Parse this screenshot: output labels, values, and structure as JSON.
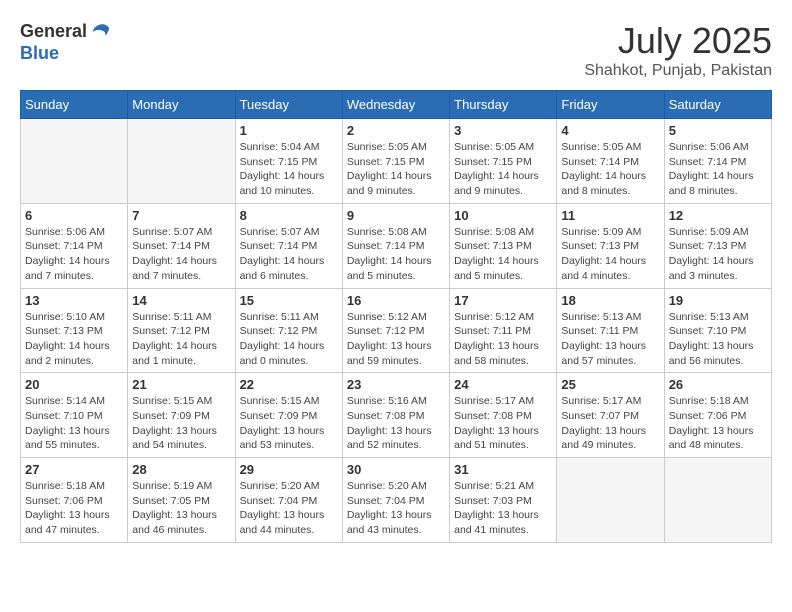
{
  "logo": {
    "general": "General",
    "blue": "Blue"
  },
  "header": {
    "title": "July 2025",
    "subtitle": "Shahkot, Punjab, Pakistan"
  },
  "days_of_week": [
    "Sunday",
    "Monday",
    "Tuesday",
    "Wednesday",
    "Thursday",
    "Friday",
    "Saturday"
  ],
  "weeks": [
    [
      {
        "day": "",
        "info": ""
      },
      {
        "day": "",
        "info": ""
      },
      {
        "day": "1",
        "info": "Sunrise: 5:04 AM\nSunset: 7:15 PM\nDaylight: 14 hours and 10 minutes."
      },
      {
        "day": "2",
        "info": "Sunrise: 5:05 AM\nSunset: 7:15 PM\nDaylight: 14 hours and 9 minutes."
      },
      {
        "day": "3",
        "info": "Sunrise: 5:05 AM\nSunset: 7:15 PM\nDaylight: 14 hours and 9 minutes."
      },
      {
        "day": "4",
        "info": "Sunrise: 5:05 AM\nSunset: 7:14 PM\nDaylight: 14 hours and 8 minutes."
      },
      {
        "day": "5",
        "info": "Sunrise: 5:06 AM\nSunset: 7:14 PM\nDaylight: 14 hours and 8 minutes."
      }
    ],
    [
      {
        "day": "6",
        "info": "Sunrise: 5:06 AM\nSunset: 7:14 PM\nDaylight: 14 hours and 7 minutes."
      },
      {
        "day": "7",
        "info": "Sunrise: 5:07 AM\nSunset: 7:14 PM\nDaylight: 14 hours and 7 minutes."
      },
      {
        "day": "8",
        "info": "Sunrise: 5:07 AM\nSunset: 7:14 PM\nDaylight: 14 hours and 6 minutes."
      },
      {
        "day": "9",
        "info": "Sunrise: 5:08 AM\nSunset: 7:14 PM\nDaylight: 14 hours and 5 minutes."
      },
      {
        "day": "10",
        "info": "Sunrise: 5:08 AM\nSunset: 7:13 PM\nDaylight: 14 hours and 5 minutes."
      },
      {
        "day": "11",
        "info": "Sunrise: 5:09 AM\nSunset: 7:13 PM\nDaylight: 14 hours and 4 minutes."
      },
      {
        "day": "12",
        "info": "Sunrise: 5:09 AM\nSunset: 7:13 PM\nDaylight: 14 hours and 3 minutes."
      }
    ],
    [
      {
        "day": "13",
        "info": "Sunrise: 5:10 AM\nSunset: 7:13 PM\nDaylight: 14 hours and 2 minutes."
      },
      {
        "day": "14",
        "info": "Sunrise: 5:11 AM\nSunset: 7:12 PM\nDaylight: 14 hours and 1 minute."
      },
      {
        "day": "15",
        "info": "Sunrise: 5:11 AM\nSunset: 7:12 PM\nDaylight: 14 hours and 0 minutes."
      },
      {
        "day": "16",
        "info": "Sunrise: 5:12 AM\nSunset: 7:12 PM\nDaylight: 13 hours and 59 minutes."
      },
      {
        "day": "17",
        "info": "Sunrise: 5:12 AM\nSunset: 7:11 PM\nDaylight: 13 hours and 58 minutes."
      },
      {
        "day": "18",
        "info": "Sunrise: 5:13 AM\nSunset: 7:11 PM\nDaylight: 13 hours and 57 minutes."
      },
      {
        "day": "19",
        "info": "Sunrise: 5:13 AM\nSunset: 7:10 PM\nDaylight: 13 hours and 56 minutes."
      }
    ],
    [
      {
        "day": "20",
        "info": "Sunrise: 5:14 AM\nSunset: 7:10 PM\nDaylight: 13 hours and 55 minutes."
      },
      {
        "day": "21",
        "info": "Sunrise: 5:15 AM\nSunset: 7:09 PM\nDaylight: 13 hours and 54 minutes."
      },
      {
        "day": "22",
        "info": "Sunrise: 5:15 AM\nSunset: 7:09 PM\nDaylight: 13 hours and 53 minutes."
      },
      {
        "day": "23",
        "info": "Sunrise: 5:16 AM\nSunset: 7:08 PM\nDaylight: 13 hours and 52 minutes."
      },
      {
        "day": "24",
        "info": "Sunrise: 5:17 AM\nSunset: 7:08 PM\nDaylight: 13 hours and 51 minutes."
      },
      {
        "day": "25",
        "info": "Sunrise: 5:17 AM\nSunset: 7:07 PM\nDaylight: 13 hours and 49 minutes."
      },
      {
        "day": "26",
        "info": "Sunrise: 5:18 AM\nSunset: 7:06 PM\nDaylight: 13 hours and 48 minutes."
      }
    ],
    [
      {
        "day": "27",
        "info": "Sunrise: 5:18 AM\nSunset: 7:06 PM\nDaylight: 13 hours and 47 minutes."
      },
      {
        "day": "28",
        "info": "Sunrise: 5:19 AM\nSunset: 7:05 PM\nDaylight: 13 hours and 46 minutes."
      },
      {
        "day": "29",
        "info": "Sunrise: 5:20 AM\nSunset: 7:04 PM\nDaylight: 13 hours and 44 minutes."
      },
      {
        "day": "30",
        "info": "Sunrise: 5:20 AM\nSunset: 7:04 PM\nDaylight: 13 hours and 43 minutes."
      },
      {
        "day": "31",
        "info": "Sunrise: 5:21 AM\nSunset: 7:03 PM\nDaylight: 13 hours and 41 minutes."
      },
      {
        "day": "",
        "info": ""
      },
      {
        "day": "",
        "info": ""
      }
    ]
  ]
}
